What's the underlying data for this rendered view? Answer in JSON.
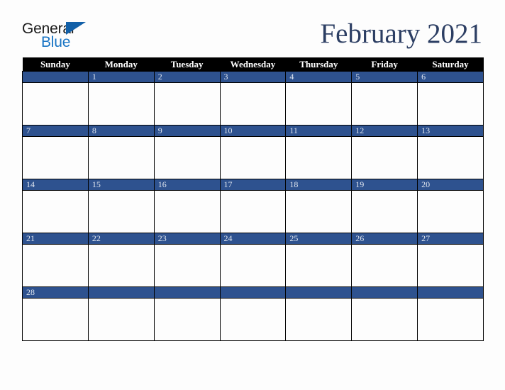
{
  "brand": {
    "name": "General Blue",
    "line1": "General",
    "line2": "Blue",
    "triangle_icon": "triangle-icon",
    "line1_color": "#1b1b1b",
    "line2_color": "#1874c4",
    "triangle_color": "#1260a8"
  },
  "header": {
    "title": "February 2021",
    "month": "February",
    "year": "2021",
    "title_color": "#2c3e63"
  },
  "theme": {
    "header_row_bg": "#000000",
    "header_row_text": "#ffffff",
    "date_bar_bg": "#2e528f",
    "date_num_text": "#dfe5ef",
    "cell_bg": "#fdfdfd",
    "grid_line": "#000000",
    "page_bg": "#fdfdfd"
  },
  "calendar": {
    "weekday_headers": [
      "Sunday",
      "Monday",
      "Tuesday",
      "Wednesday",
      "Thursday",
      "Friday",
      "Saturday"
    ],
    "weeks": [
      {
        "days": [
          {
            "date": ""
          },
          {
            "date": "1"
          },
          {
            "date": "2"
          },
          {
            "date": "3"
          },
          {
            "date": "4"
          },
          {
            "date": "5"
          },
          {
            "date": "6"
          }
        ]
      },
      {
        "days": [
          {
            "date": "7"
          },
          {
            "date": "8"
          },
          {
            "date": "9"
          },
          {
            "date": "10"
          },
          {
            "date": "11"
          },
          {
            "date": "12"
          },
          {
            "date": "13"
          }
        ]
      },
      {
        "days": [
          {
            "date": "14"
          },
          {
            "date": "15"
          },
          {
            "date": "16"
          },
          {
            "date": "17"
          },
          {
            "date": "18"
          },
          {
            "date": "19"
          },
          {
            "date": "20"
          }
        ]
      },
      {
        "days": [
          {
            "date": "21"
          },
          {
            "date": "22"
          },
          {
            "date": "23"
          },
          {
            "date": "24"
          },
          {
            "date": "25"
          },
          {
            "date": "26"
          },
          {
            "date": "27"
          }
        ]
      },
      {
        "days": [
          {
            "date": "28"
          },
          {
            "date": ""
          },
          {
            "date": ""
          },
          {
            "date": ""
          },
          {
            "date": ""
          },
          {
            "date": ""
          },
          {
            "date": ""
          }
        ]
      }
    ]
  }
}
